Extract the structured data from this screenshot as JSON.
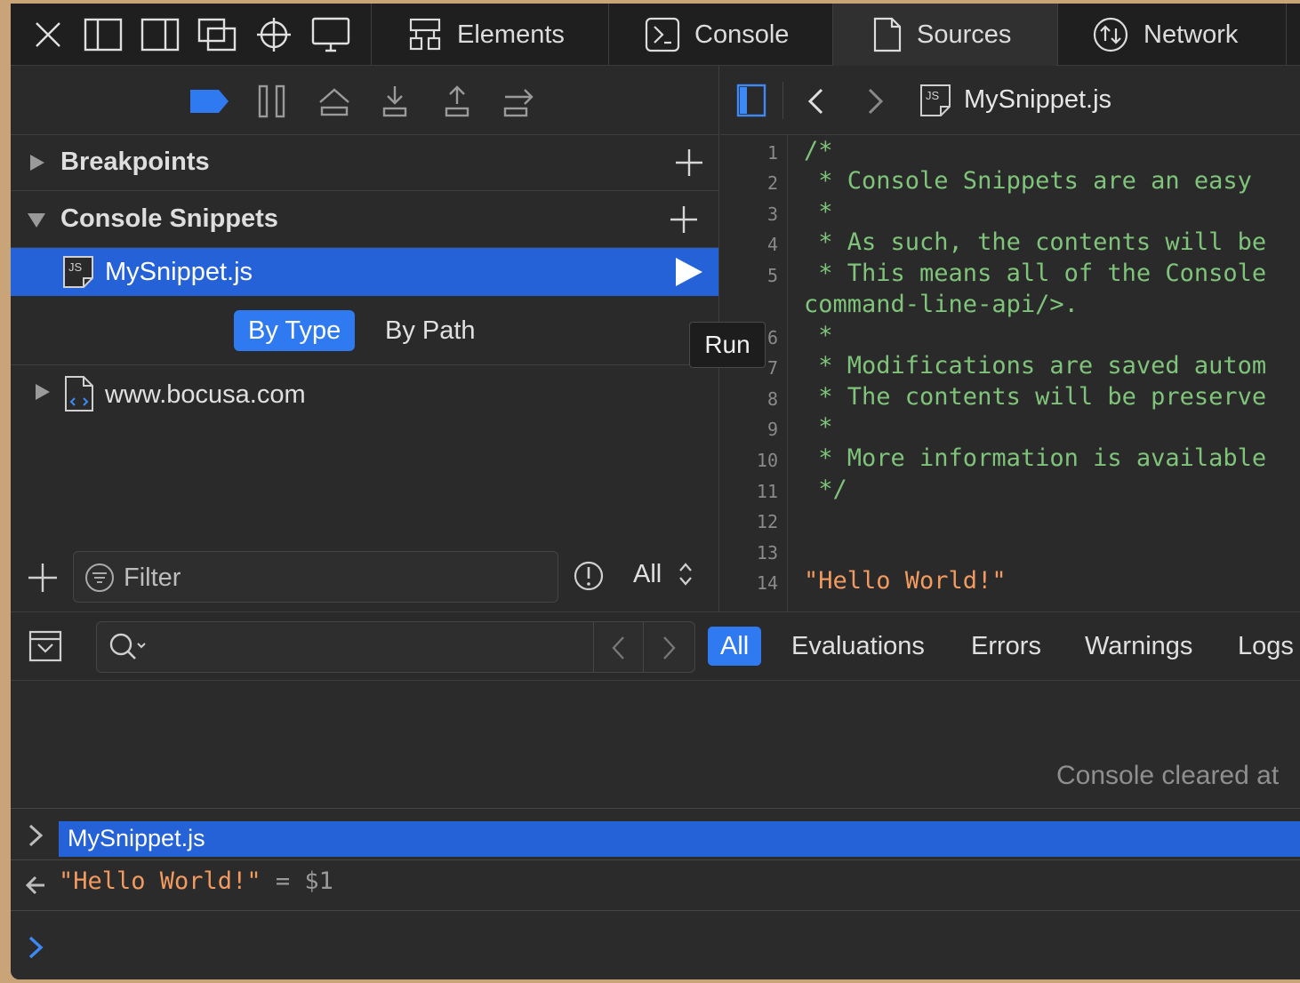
{
  "toolbar": {
    "tabs": [
      {
        "label": "Elements",
        "icon": "elements-icon"
      },
      {
        "label": "Console",
        "icon": "console-icon"
      },
      {
        "label": "Sources",
        "icon": "sources-icon"
      },
      {
        "label": "Network",
        "icon": "network-icon"
      }
    ],
    "active_tab": "Sources"
  },
  "sidebar": {
    "breakpoints_label": "Breakpoints",
    "snippets_label": "Console Snippets",
    "selected_snippet": "MySnippet.js",
    "group_by": {
      "by_type": "By Type",
      "by_path": "By Path",
      "selected": "By Type"
    },
    "resource": "www.bocusa.com",
    "filter_placeholder": "Filter",
    "level_select": "All"
  },
  "tooltip": {
    "text": "Run"
  },
  "editor": {
    "filename": "MySnippet.js",
    "line_numbers": [
      "1",
      "2",
      "3",
      "4",
      "5",
      "6",
      "7",
      "8",
      "9",
      "10",
      "11",
      "12",
      "13",
      "14"
    ],
    "lines": [
      "/*",
      " * Console Snippets are an easy",
      " *",
      " * As such, the contents will be",
      " * This means all of the Console",
      "command-line-api/>.",
      " *",
      " * Modifications are saved autom",
      " * The contents will be preserve",
      " *",
      " * More information is available",
      " */",
      "",
      "\"Hello World!\""
    ]
  },
  "console": {
    "filters": [
      "All",
      "Evaluations",
      "Errors",
      "Warnings",
      "Logs"
    ],
    "active_filter": "All",
    "cleared_message": "Console cleared at",
    "input_entry": "MySnippet.js",
    "output_value": "\"Hello World!\"",
    "output_assign": " = $1"
  },
  "colors": {
    "accent": "#2f7af1",
    "selection": "#2562d8",
    "comment": "#7fc47a",
    "string": "#f29a5f"
  }
}
